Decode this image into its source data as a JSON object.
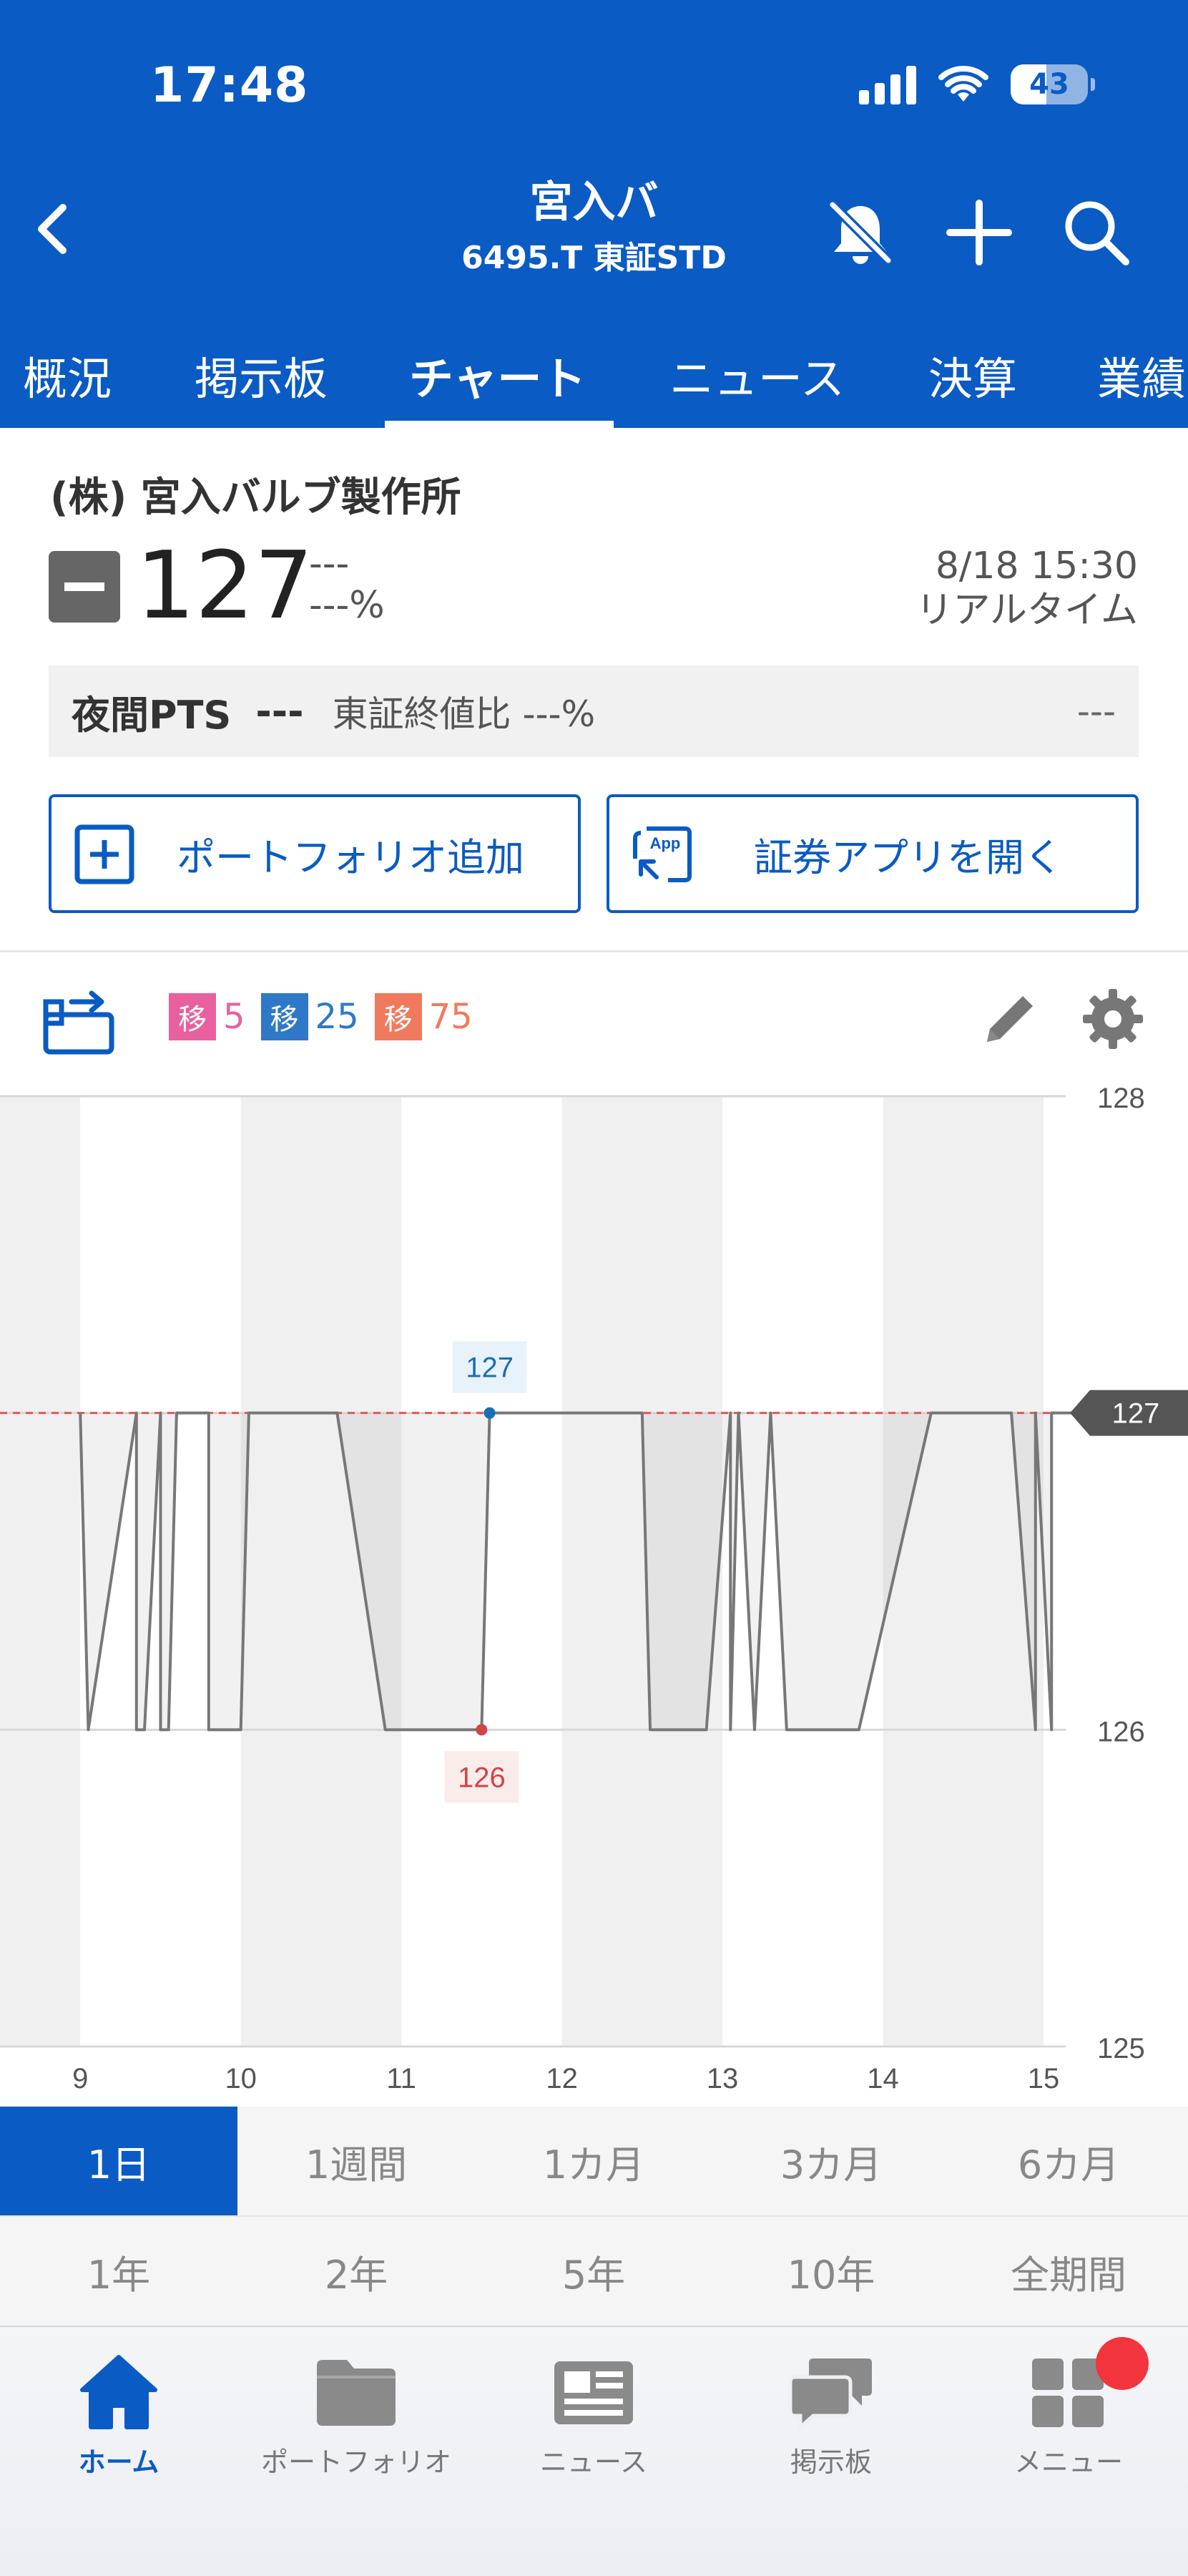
{
  "status": {
    "time": "17:48",
    "battery": "43"
  },
  "header": {
    "title": "宮入バ",
    "subtitle": "6495.T 東証STD",
    "icons": [
      "back-chevron-icon",
      "bell-off-icon",
      "plus-icon",
      "search-icon"
    ]
  },
  "tabs": [
    {
      "label": "概況"
    },
    {
      "label": "掲示板"
    },
    {
      "label": "チャート"
    },
    {
      "label": "ニュース"
    },
    {
      "label": "決算"
    },
    {
      "label": "業績"
    }
  ],
  "active_tab": "チャート",
  "quote": {
    "company": "(株) 宮入バルブ製作所",
    "price": "127",
    "change": "---",
    "change_pct": "---%",
    "date": "8/18 15:30",
    "realtime": "リアルタイム"
  },
  "pts": {
    "label": "夜間PTS",
    "value": "---",
    "ratio": "東証終値比 ---%",
    "right": "---"
  },
  "actions": {
    "portfolio": "ポートフォリオ追加",
    "open_app": "証券アプリを開く",
    "app_icon_text": "App"
  },
  "moving_averages": [
    {
      "label": "移",
      "value": "5",
      "color": "#e8609e"
    },
    {
      "label": "移",
      "value": "25",
      "color": "#2f78c8"
    },
    {
      "label": "移",
      "value": "75",
      "color": "#f07a5e"
    }
  ],
  "chart_data": {
    "type": "line",
    "x_ticks": [
      "9",
      "10",
      "11",
      "12",
      "13",
      "14",
      "15"
    ],
    "y_ticks": [
      "128",
      "127",
      "126",
      "125"
    ],
    "ylim": [
      125,
      128
    ],
    "xlim": [
      8.5,
      15.9
    ],
    "current_label": "127",
    "high_label": "127",
    "low_label": "126",
    "reference_line": 127,
    "series": [
      {
        "color": "#777777",
        "x": [
          9.0,
          9.05,
          9.35,
          9.35,
          9.4,
          9.5,
          9.5,
          9.55,
          9.6,
          9.8,
          9.8,
          10.0,
          10.05,
          10.6,
          10.9,
          11.2,
          11.5,
          11.55,
          12.5,
          12.55,
          12.9,
          13.05,
          13.05,
          13.1,
          13.2,
          13.3,
          13.4,
          13.85,
          14.3,
          14.8,
          14.95,
          14.95,
          15.05,
          15.05,
          15.35,
          15.5
        ],
        "y": [
          127,
          126,
          127,
          126,
          126,
          127,
          126,
          126,
          127,
          127,
          126,
          126,
          127,
          127,
          126,
          126,
          126,
          127,
          127,
          126,
          126,
          127,
          126,
          127,
          126,
          127,
          126,
          126,
          127,
          127,
          126,
          127,
          126,
          127,
          127,
          127
        ]
      }
    ]
  },
  "periods_row1": [
    "1日",
    "1週間",
    "1カ月",
    "3カ月",
    "6カ月"
  ],
  "periods_row2": [
    "1年",
    "2年",
    "5年",
    "10年",
    "全期間"
  ],
  "active_period": "1日",
  "bottom_nav": [
    {
      "label": "ホーム",
      "icon": "home-icon"
    },
    {
      "label": "ポートフォリオ",
      "icon": "folder-icon"
    },
    {
      "label": "ニュース",
      "icon": "newspaper-icon"
    },
    {
      "label": "掲示板",
      "icon": "chat-bubbles-icon"
    },
    {
      "label": "メニュー",
      "icon": "grid-menu-icon"
    }
  ],
  "colors": {
    "brand": "#0a5bc4",
    "ref_line": "#e05a5a",
    "high": "#1a6fb3",
    "low": "#d04545"
  }
}
